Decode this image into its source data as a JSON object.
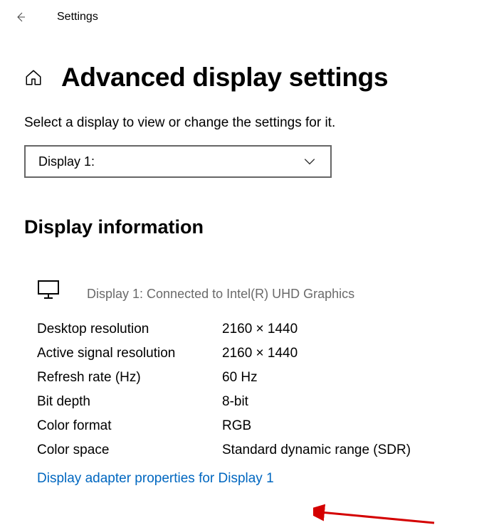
{
  "topBar": {
    "appTitle": "Settings"
  },
  "page": {
    "title": "Advanced display settings",
    "prompt": "Select a display to view or change the settings for it."
  },
  "dropdown": {
    "selected": "Display 1:"
  },
  "displayInfo": {
    "sectionTitle": "Display information",
    "connectionText": "Display 1: Connected to Intel(R) UHD Graphics",
    "specs": [
      {
        "label": "Desktop resolution",
        "value": "2160 × 1440"
      },
      {
        "label": "Active signal resolution",
        "value": "2160 × 1440"
      },
      {
        "label": "Refresh rate (Hz)",
        "value": "60 Hz"
      },
      {
        "label": "Bit depth",
        "value": "8-bit"
      },
      {
        "label": "Color format",
        "value": "RGB"
      },
      {
        "label": "Color space",
        "value": "Standard dynamic range (SDR)"
      }
    ],
    "adapterLink": "Display adapter properties for Display 1"
  }
}
